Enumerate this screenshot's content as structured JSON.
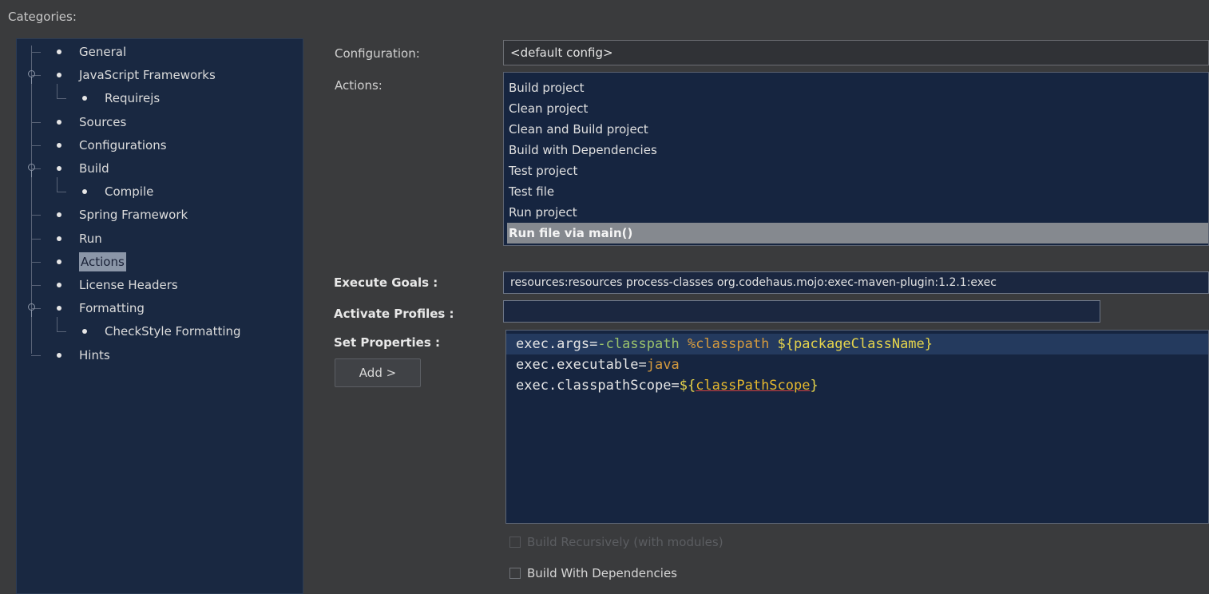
{
  "categories": {
    "label": "Categories:",
    "items": [
      {
        "label": "General",
        "expandable": false,
        "level": 0
      },
      {
        "label": "JavaScript Frameworks",
        "expandable": true,
        "level": 0
      },
      {
        "label": "Requirejs",
        "expandable": false,
        "level": 1
      },
      {
        "label": "Sources",
        "expandable": false,
        "level": 0
      },
      {
        "label": "Configurations",
        "expandable": false,
        "level": 0
      },
      {
        "label": "Build",
        "expandable": true,
        "level": 0
      },
      {
        "label": "Compile",
        "expandable": false,
        "level": 1
      },
      {
        "label": "Spring Framework",
        "expandable": false,
        "level": 0
      },
      {
        "label": "Run",
        "expandable": false,
        "level": 0
      },
      {
        "label": "Actions",
        "expandable": false,
        "level": 0,
        "selected": true
      },
      {
        "label": "License Headers",
        "expandable": false,
        "level": 0
      },
      {
        "label": "Formatting",
        "expandable": true,
        "level": 0
      },
      {
        "label": "CheckStyle Formatting",
        "expandable": false,
        "level": 1
      },
      {
        "label": "Hints",
        "expandable": false,
        "level": 0
      }
    ]
  },
  "form": {
    "configuration_label": "Configuration:",
    "configuration_value": "<default config>",
    "actions_label": "Actions:",
    "actions": [
      {
        "label": "Build project"
      },
      {
        "label": "Clean project"
      },
      {
        "label": "Clean and Build project"
      },
      {
        "label": "Build with Dependencies"
      },
      {
        "label": "Test project"
      },
      {
        "label": "Test file"
      },
      {
        "label": "Run project"
      },
      {
        "label": "Run file via main()",
        "selected": true
      }
    ],
    "execute_goals_label": "Execute Goals :",
    "execute_goals_value": "resources:resources process-classes org.codehaus.mojo:exec-maven-plugin:1.2.1:exec",
    "activate_profiles_label": "Activate Profiles :",
    "activate_profiles_value": "",
    "set_properties_label": "Set Properties :",
    "add_button_label": "Add >",
    "properties": [
      {
        "key": "exec.args=",
        "parts": [
          {
            "text": "-classpath ",
            "color": "green"
          },
          {
            "text": "%classpath ",
            "color": "orange"
          },
          {
            "text": "${packageClassName}",
            "color": "yellow"
          }
        ]
      },
      {
        "key": "exec.executable=",
        "parts": [
          {
            "text": "java",
            "color": "orange"
          }
        ]
      },
      {
        "key": "exec.classpathScope=",
        "parts": [
          {
            "text": "${",
            "color": "yellow"
          },
          {
            "text": "classPathScope",
            "color": "var"
          },
          {
            "text": "}",
            "color": "yellow"
          }
        ]
      }
    ],
    "build_recursively_label": "Build Recursively (with modules)",
    "build_recursively_enabled": false,
    "build_with_deps_label": "Build With Dependencies"
  },
  "colors": {
    "background": "#3a3b3d",
    "tree_background": "#192841",
    "list_background": "#162540",
    "selection": "#85898f",
    "accent_green": "#9bc26b",
    "accent_orange": "#d59a3e",
    "accent_yellow": "#e5d44c"
  }
}
